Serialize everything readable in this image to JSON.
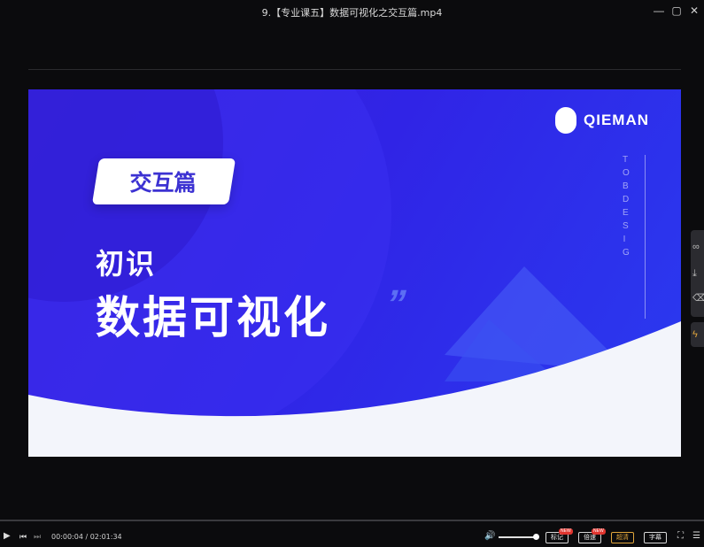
{
  "window": {
    "title": "9.【专业课五】数据可视化之交互篇.mp4",
    "controls": {
      "minimize": "—",
      "maximize": "▢",
      "close": "✕"
    }
  },
  "slide": {
    "logo_text": "QIEMAN",
    "vertical_text": "TOBDESIG",
    "badge": "交互篇",
    "subtitle": "初识",
    "heading": "数据可视化",
    "quote_mark": "”"
  },
  "side_tools": [
    {
      "icon": "link-icon",
      "glyph": "∞"
    },
    {
      "icon": "download-icon",
      "glyph": "⤓"
    },
    {
      "icon": "delete-icon",
      "glyph": "⌫"
    },
    {
      "icon": "lightning-icon",
      "glyph": "ϟ"
    }
  ],
  "player": {
    "current_time": "00:00:04",
    "total_time": "02:01:34",
    "time_separator": " / ",
    "progress": 0.0,
    "volume": 0.9,
    "buttons": {
      "mark": "标记",
      "speed": "倍速",
      "quality": "超清",
      "subtitles": "字幕"
    },
    "new_tag": "NEW",
    "glyphs": {
      "play": "▶",
      "prev": "⏮",
      "next": "⏭",
      "volume": "🔊",
      "fullscreen": "⛶",
      "playlist": "☰"
    }
  },
  "colors": {
    "background": "#0b0b0d",
    "slide_blue": "#3024e6",
    "accent_quality": "#e0a53b",
    "new_tag": "#e0352f"
  }
}
